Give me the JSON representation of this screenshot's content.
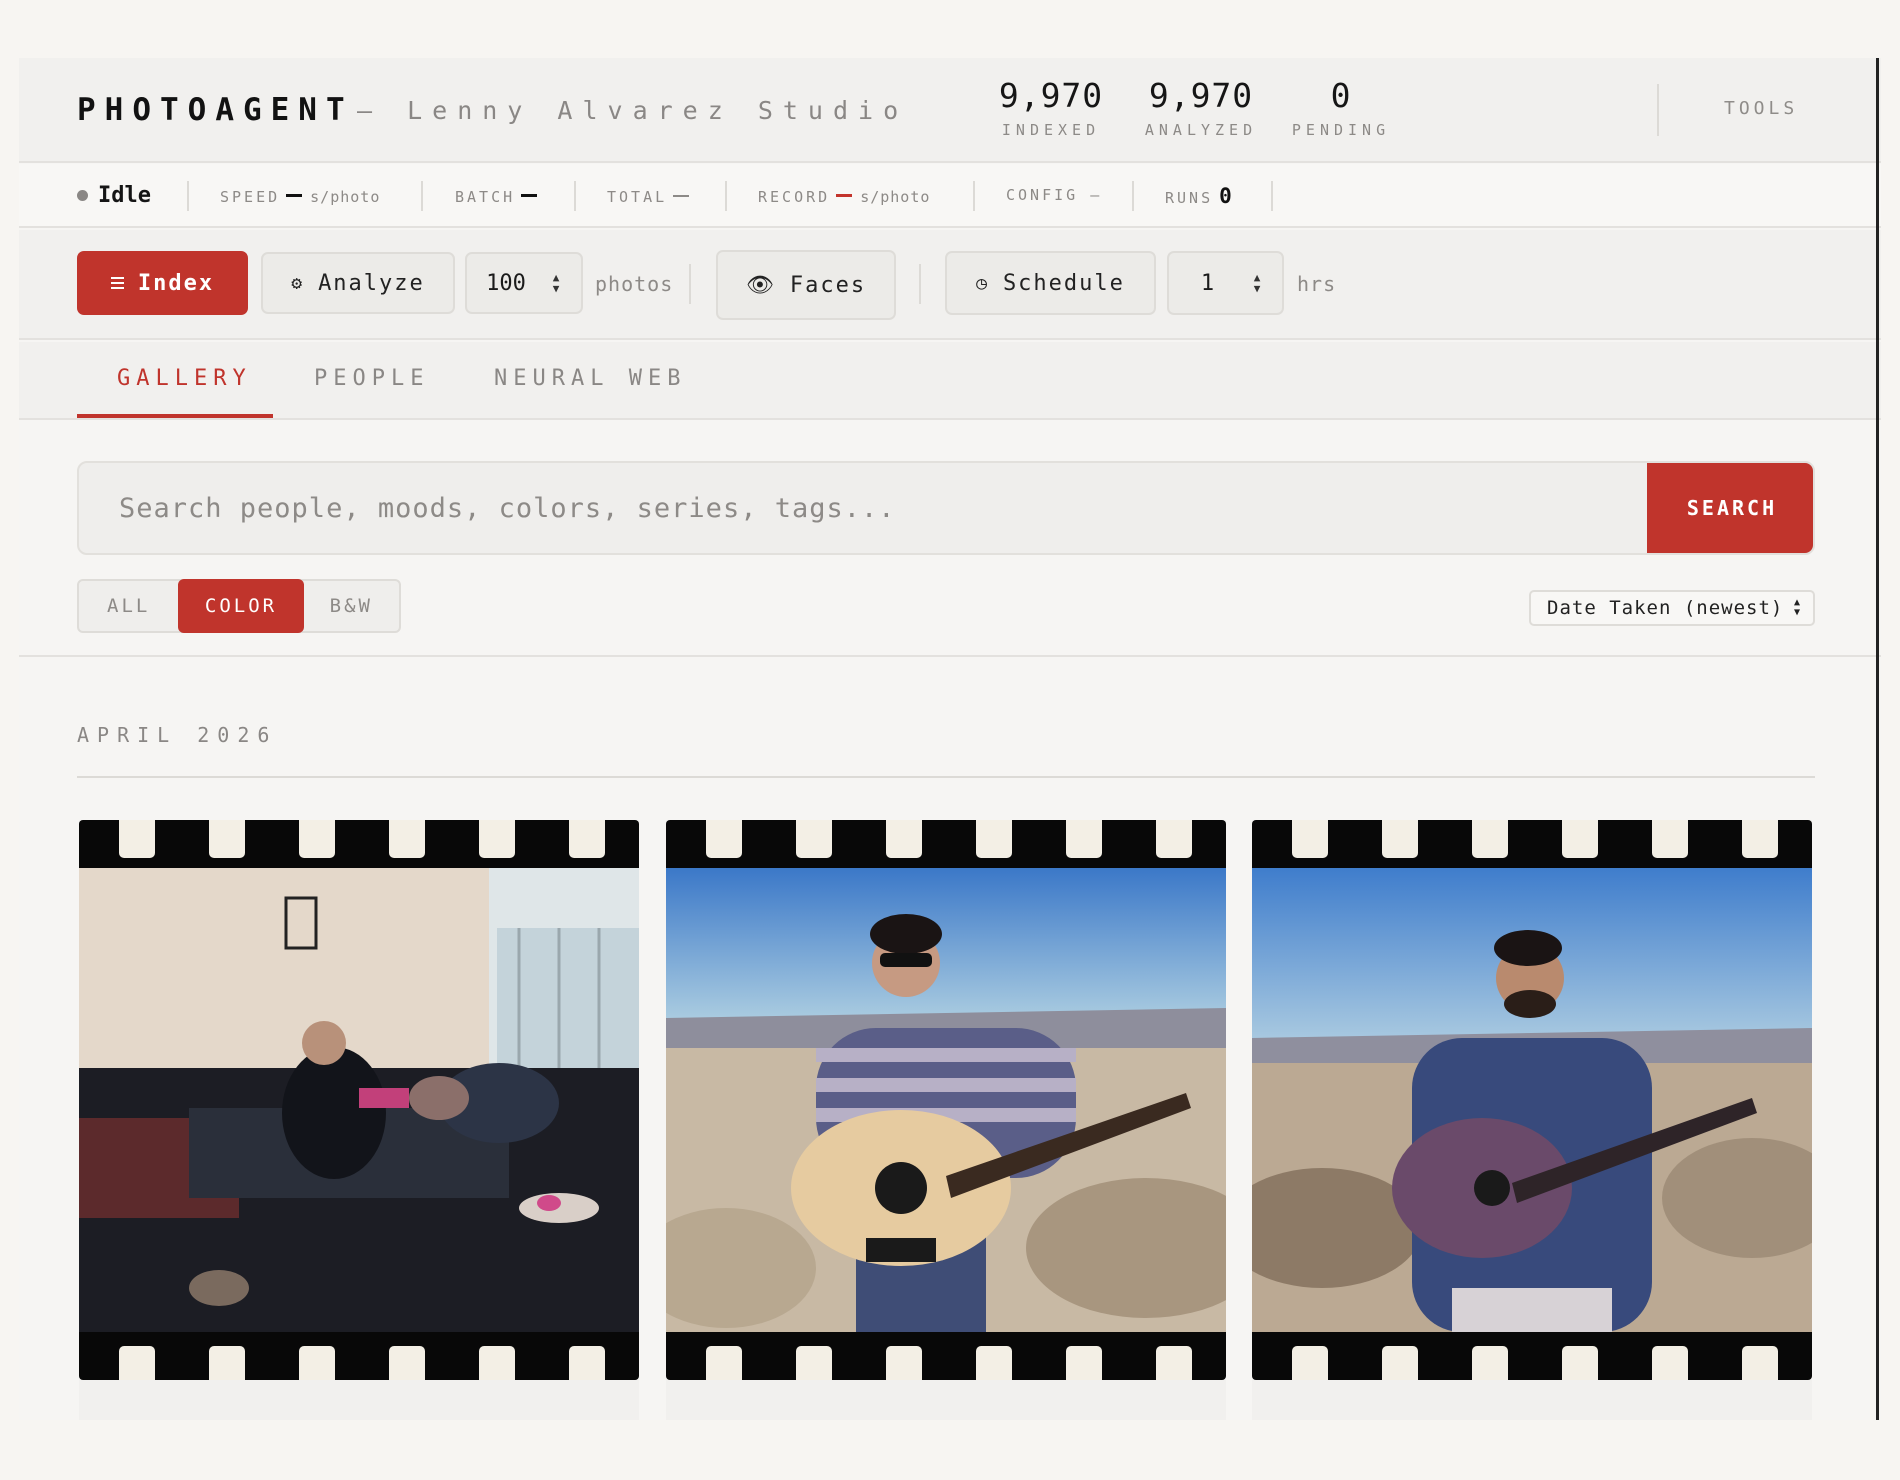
{
  "header": {
    "brand": "PHOTOAGENT",
    "studio": "— Lenny Alvarez Studio",
    "stats": [
      {
        "value": "9,970",
        "label": "INDEXED"
      },
      {
        "value": "9,970",
        "label": "ANALYZED"
      },
      {
        "value": "0",
        "label": "PENDING"
      }
    ],
    "tools_label": "TOOLS"
  },
  "status_bar": {
    "state": "Idle",
    "speed_label": "SPEED",
    "speed_unit": "s/photo",
    "batch_label": "BATCH",
    "total_label": "TOTAL",
    "record_label": "RECORD",
    "record_unit": "s/photo",
    "config_label": "CONFIG —",
    "runs_label": "RUNS",
    "runs_value": "0"
  },
  "toolbar": {
    "index_label": "Index",
    "analyze_label": "Analyze",
    "batch_value": "100",
    "batch_unit": "photos",
    "faces_label": "Faces",
    "schedule_label": "Schedule",
    "hours_value": "1",
    "hours_unit": "hrs"
  },
  "tabs": [
    {
      "label": "GALLERY",
      "active": true
    },
    {
      "label": "PEOPLE",
      "active": false
    },
    {
      "label": "NEURAL WEB",
      "active": false
    }
  ],
  "search": {
    "placeholder": "Search people, moods, colors, series, tags...",
    "button_label": "SEARCH"
  },
  "filters": {
    "options": [
      "ALL",
      "COLOR",
      "B&W"
    ],
    "selected": "COLOR",
    "sort_label": "Date Taken (newest)"
  },
  "gallery": {
    "month": "APRIL 2026",
    "photos": [
      {
        "subject": "man seated in apartment room"
      },
      {
        "subject": "man with guitar in desert, sunglasses"
      },
      {
        "subject": "man with guitar in desert"
      }
    ]
  },
  "colors": {
    "accent": "#c0342c",
    "background": "#f6f5f3",
    "muted_text": "#8d8a87"
  }
}
